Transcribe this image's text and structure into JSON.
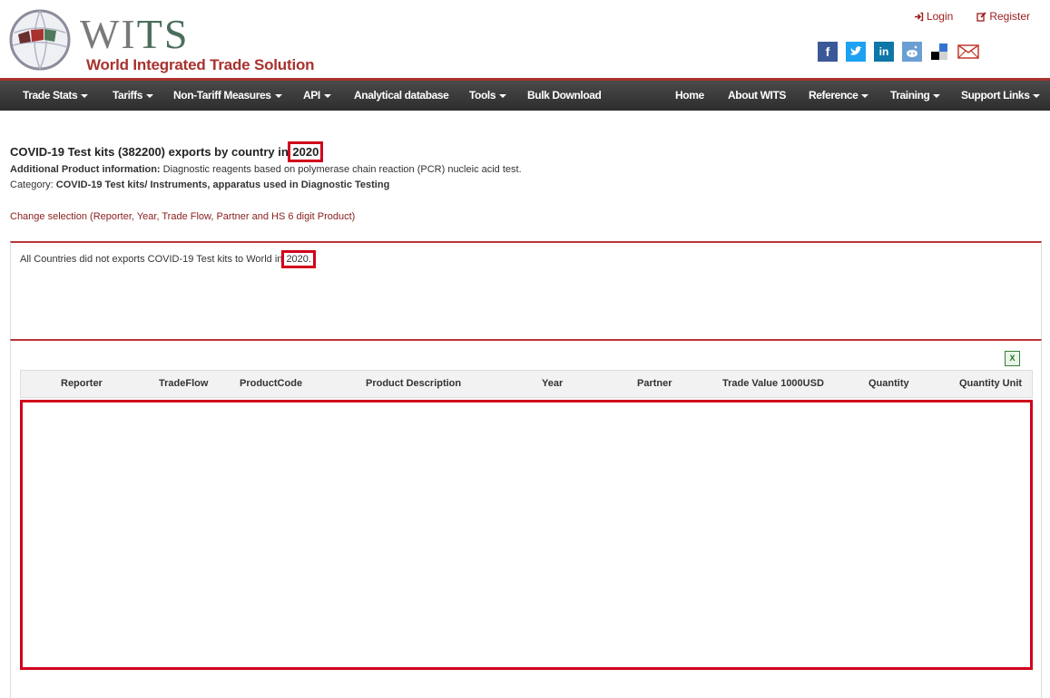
{
  "header": {
    "logo_text_1": "WI",
    "logo_text_2": "TS",
    "logo_subtitle": "World Integrated Trade Solution",
    "login": "Login",
    "register": "Register",
    "social_icons": [
      "facebook-icon",
      "twitter-icon",
      "linkedin-icon",
      "reddit-icon",
      "delicious-icon",
      "email-icon"
    ]
  },
  "nav": {
    "items": [
      "Trade Stats",
      "Tariffs",
      "Non-Tariff Measures",
      "API",
      "Analytical database",
      "Tools",
      "Bulk Download",
      "Home",
      "About WITS",
      "Reference",
      "Training",
      "Support Links"
    ]
  },
  "main": {
    "title_prefix": "COVID-19 Test kits (382200) exports by country in ",
    "title_year": "2020",
    "info1_label": "Additional Product information:",
    "info1_text": " Diagnostic reagents based on polymerase chain reaction (PCR) nucleic acid test.",
    "info2_label": "Category: ",
    "info2_text": "COVID-19 Test kits/ Instruments, apparatus used in Diagnostic Testing",
    "change_selection": "Change selection (Reporter, Year, Trade Flow, Partner and HS 6 digit Product)",
    "message_prefix": "All Countries did not exports COVID-19 Test kits to World in ",
    "message_year": "2020."
  },
  "table": {
    "columns": [
      "Reporter",
      "TradeFlow",
      "ProductCode",
      "Product Description",
      "Year",
      "Partner",
      "Trade Value 1000USD",
      "Quantity",
      "Quantity Unit"
    ],
    "rows": []
  },
  "colors": {
    "brand_red": "#a8322e",
    "highlight": "#d0021b",
    "nav_bg": "#333333"
  }
}
